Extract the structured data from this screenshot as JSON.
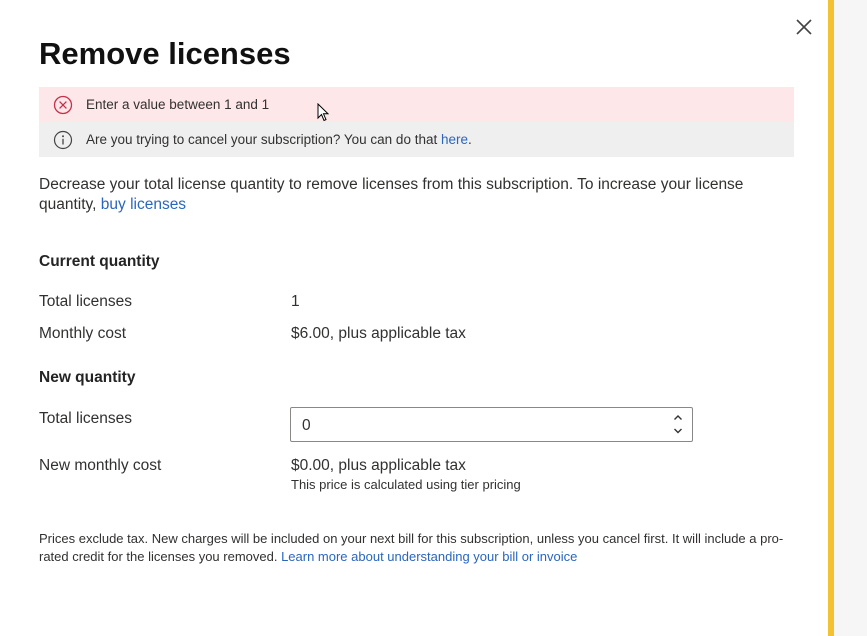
{
  "dialog": {
    "title": "Remove licenses",
    "close_icon": "close-icon"
  },
  "alerts": {
    "error": {
      "icon": "error-circle-icon",
      "text": "Enter a value between 1 and 1"
    },
    "info": {
      "icon": "info-circle-icon",
      "text": "Are you trying to cancel your subscription? You can do that ",
      "link": "here",
      "suffix": "."
    }
  },
  "description": {
    "text": "Decrease your total license quantity to remove licenses from this subscription. To increase your license quantity, ",
    "link": "buy licenses"
  },
  "current": {
    "heading": "Current quantity",
    "licenses_label": "Total licenses",
    "licenses_value": "1",
    "cost_label": "Monthly cost",
    "cost_value": "$6.00, plus applicable tax"
  },
  "new": {
    "heading": "New quantity",
    "licenses_label": "Total licenses",
    "licenses_input_value": "0",
    "cost_label": "New monthly cost",
    "cost_value": "$0.00, plus applicable tax",
    "cost_note": "This price is calculated using tier pricing"
  },
  "footer": {
    "text": "Prices exclude tax. New charges will be included on your next bill for this subscription, unless you cancel first. It will include a pro-rated credit for the licenses you removed. ",
    "link": "Learn more about understanding your bill or invoice"
  },
  "colors": {
    "error_background": "#fde7e9",
    "info_background": "#efefef",
    "link": "#2b66bd",
    "accent_bar": "#f2c230"
  }
}
